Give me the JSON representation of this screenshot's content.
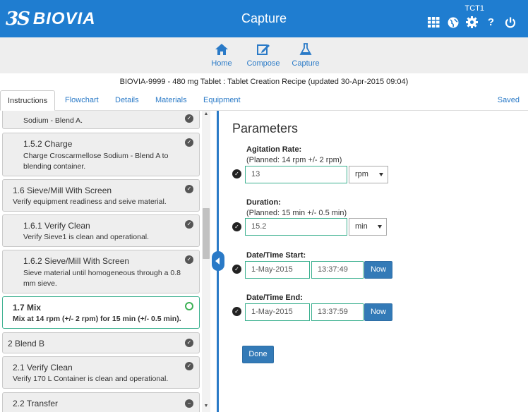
{
  "header": {
    "logo_mark": "3S",
    "logo_text": "BIOVIA",
    "app_title": "Capture",
    "user": "TCT1",
    "icons": [
      "grid-icon",
      "globe-icon",
      "gear-icon",
      "help-icon",
      "power-icon"
    ]
  },
  "nav": [
    {
      "label": "Home",
      "icon": "home-icon"
    },
    {
      "label": "Compose",
      "icon": "edit-icon"
    },
    {
      "label": "Capture",
      "icon": "flask-icon"
    }
  ],
  "recipe_title": "BIOVIA-9999 - 480 mg Tablet : Tablet Creation Recipe (updated 30-Apr-2015 09:04)",
  "tabs": [
    "Instructions",
    "Flowchart",
    "Details",
    "Materials",
    "Equipment"
  ],
  "active_tab": "Instructions",
  "saved_label": "Saved",
  "steps": [
    {
      "title": "",
      "desc": "Sodium - Blend A.",
      "status": "done"
    },
    {
      "title": "1.5.2 Charge",
      "desc": "Charge Croscarmellose Sodium - Blend A to blending container.",
      "status": "done"
    },
    {
      "title": "1.6 Sieve/Mill With Screen",
      "desc": "Verify equipment readiness and seive material.",
      "status": "done"
    },
    {
      "title": "1.6.1 Verify Clean",
      "desc": "Verify Sieve1 is clean and operational.",
      "status": "done"
    },
    {
      "title": "1.6.2 Sieve/Mill With Screen",
      "desc": "Sieve material until homogeneous through a 0.8 mm sieve.",
      "status": "done"
    },
    {
      "title": "1.7 Mix",
      "desc": "Mix at 14 rpm (+/- 2 rpm) for 15 min (+/- 0.5 min).",
      "status": "active"
    },
    {
      "title": "2 Blend B",
      "desc": "",
      "status": "done"
    },
    {
      "title": "2.1 Verify Clean",
      "desc": "Verify 170 L Container is clean and operational.",
      "status": "done"
    },
    {
      "title": "2.2 Transfer",
      "desc": "",
      "status": "pending"
    }
  ],
  "parameters": {
    "title": "Parameters",
    "agitation": {
      "label": "Agitation Rate:",
      "planned": "(Planned: 14 rpm +/- 2 rpm)",
      "value": "13",
      "unit": "rpm"
    },
    "duration": {
      "label": "Duration:",
      "planned": "(Planned: 15 min +/- 0.5 min)",
      "value": "15.2",
      "unit": "min"
    },
    "start": {
      "label": "Date/Time Start:",
      "date": "1-May-2015",
      "time": "13:37:49",
      "now": "Now"
    },
    "end": {
      "label": "Date/Time End:",
      "date": "1-May-2015",
      "time": "13:37:59",
      "now": "Now"
    },
    "done": "Done"
  }
}
